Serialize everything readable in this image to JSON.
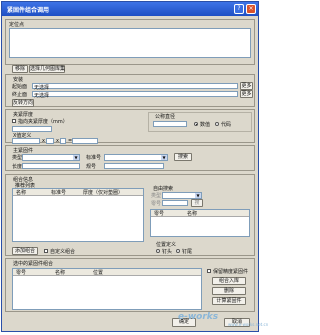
{
  "window": {
    "title": "紧固件组合调用"
  },
  "location": {
    "group_label": "定位点",
    "delete_button": "移除",
    "select_button": "选择几何图库集"
  },
  "stack": {
    "group_label": "安装",
    "start_label": "起始面",
    "start_value": "无选择",
    "end_label": "终止面",
    "end_value": "无选择",
    "more_button": "更多",
    "reverse_button": "反转方向"
  },
  "thickness": {
    "group_label": "夹紧厚度",
    "check_label": "指向夹紧厚度（mm）",
    "diameter_group_label": "公称直径",
    "numeric_label": "数值",
    "code_label": "代码",
    "xy_label": "X值定义",
    "x_sep": "x",
    "y_sep": "x",
    "z_sep": "="
  },
  "main_part": {
    "group_label": "主紧固件",
    "type_label": "类型",
    "standard_label": "标准号",
    "length_label": "长度",
    "spec_label": "规号",
    "search_button": "搜索"
  },
  "combo": {
    "group_label": "组合信息",
    "list_label": "推荐列表",
    "columns": [
      "名称",
      "标准号",
      "厚度（仅对垫圈）"
    ],
    "search_label": "自由搜索",
    "type_label": "类型",
    "code_label": "零号",
    "search_btn": "搜",
    "right_columns": [
      "零号",
      "名称"
    ],
    "add_button": "添加组合",
    "custom_label": "自定义组合",
    "position_label": "位置定义",
    "pos_head": "钉头",
    "pos_nut": "钉尾"
  },
  "selected": {
    "group_label": "选中的紧固件组合",
    "columns": [
      "零号",
      "名称",
      "位置"
    ],
    "keep_label": "保留精度紧固件",
    "insert_button": "组合入库",
    "delete_button": "删除",
    "calc_button": "计算紧固件"
  },
  "footer": {
    "ok_button": "确定",
    "cancel_button": "取消"
  },
  "watermark": {
    "text": "e-works",
    "sub": "www.e-works.net.cn"
  }
}
